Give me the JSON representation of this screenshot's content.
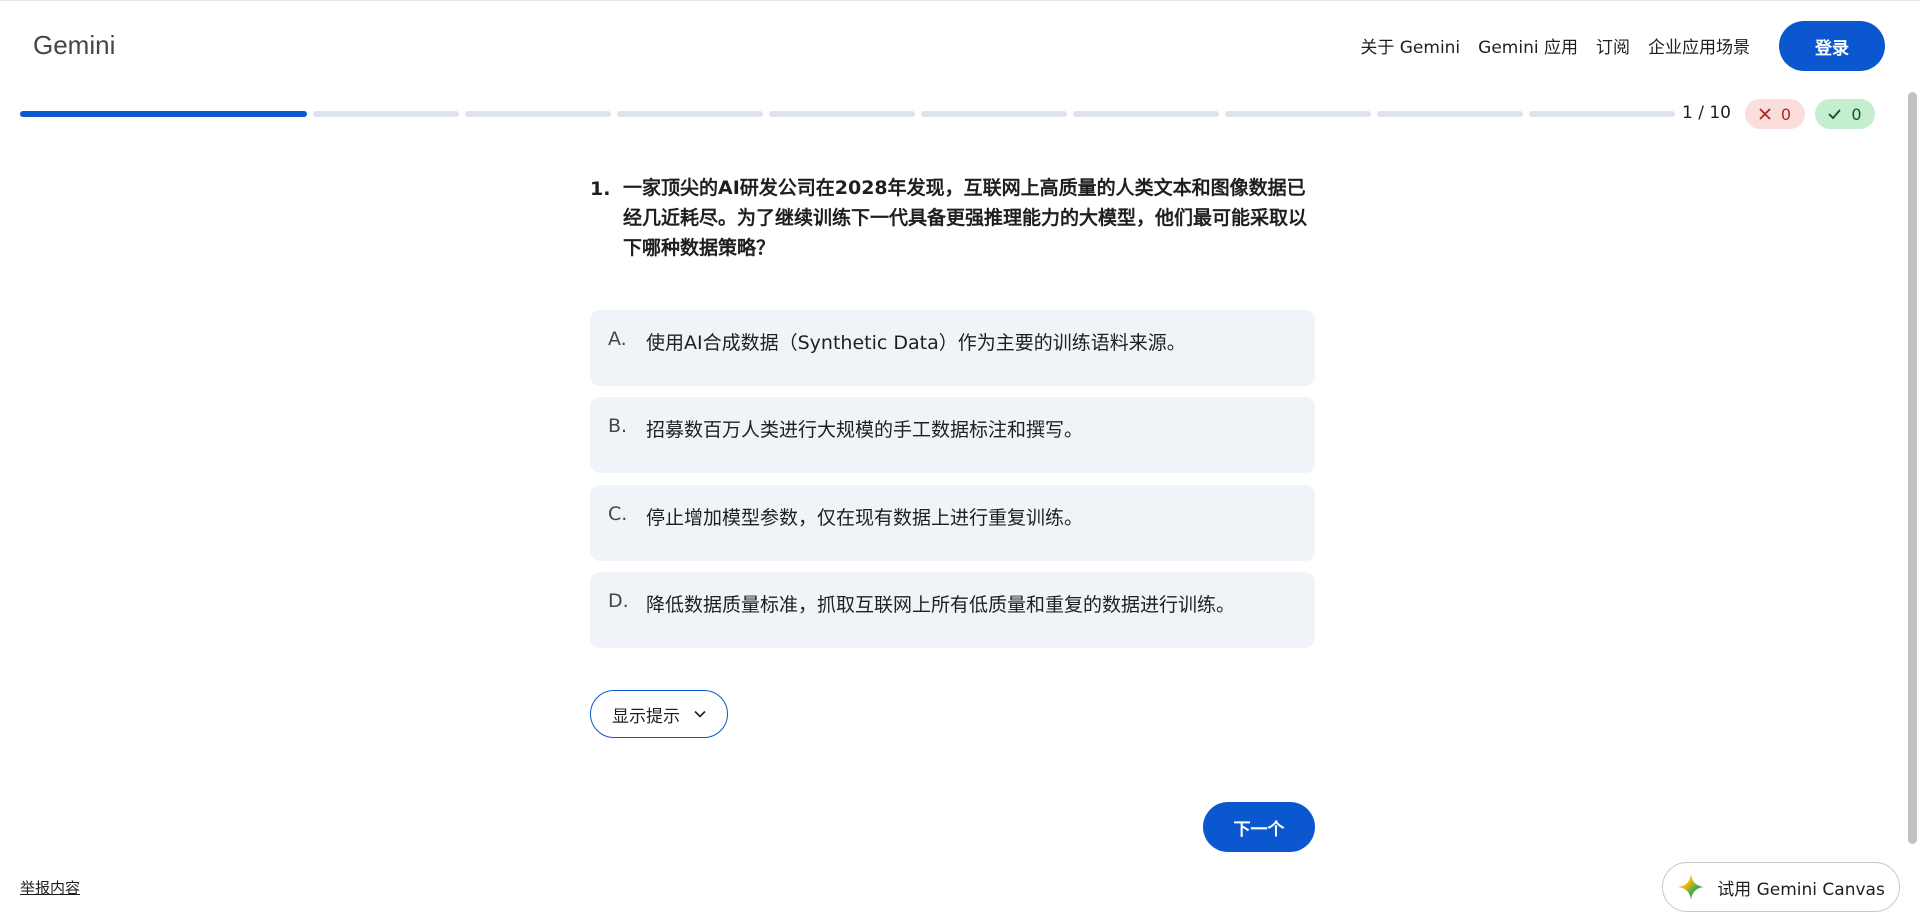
{
  "header": {
    "brand": "Gemini",
    "nav": [
      "关于 Gemini",
      "Gemini 应用",
      "订阅",
      "企业应用场景"
    ],
    "login_label": "登录"
  },
  "progress": {
    "current": 1,
    "total": 10,
    "counter_text": "1 / 10",
    "wrong_count": "0",
    "right_count": "0"
  },
  "question": {
    "number": "1.",
    "text": "一家顶尖的AI研发公司在2028年发现，互联网上高质量的人类文本和图像数据已经几近耗尽。为了继续训练下一代具备更强推理能力的大模型，他们最可能采取以下哪种数据策略？"
  },
  "options": [
    {
      "letter": "A.",
      "text": "使用AI合成数据（Synthetic Data）作为主要的训练语料来源。"
    },
    {
      "letter": "B.",
      "text": "招募数百万人类进行大规模的手工数据标注和撰写。"
    },
    {
      "letter": "C.",
      "text": "停止增加模型参数，仅在现有数据上进行重复训练。"
    },
    {
      "letter": "D.",
      "text": "降低数据质量标准，抓取互联网上所有低质量和重复的数据进行训练。"
    }
  ],
  "hint_label": "显示提示",
  "next_label": "下一个",
  "report_label": "举报内容",
  "canvas_label": "试用 Gemini Canvas",
  "colors": {
    "primary": "#0b57d0",
    "option_bg": "#f0f4f9",
    "wrong_bg": "#f9dedc",
    "right_bg": "#c4eed0"
  }
}
